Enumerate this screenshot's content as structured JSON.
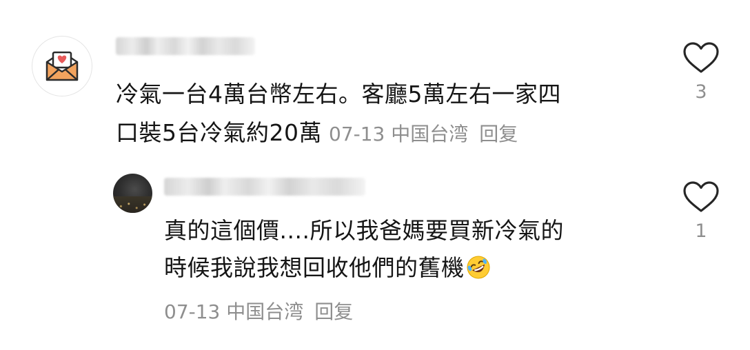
{
  "comment": {
    "avatar_icon": "envelope-heart-icon",
    "username": "",
    "text_line_1": "冷氣一台4萬台幣左右。客廳5萬左右一家四",
    "text_line_2": "口裝5台冷氣約20萬",
    "date": "07-13",
    "location": "中国台湾",
    "reply_label": "回复",
    "likes": "3"
  },
  "reply": {
    "avatar_icon": "night-city-avatar",
    "username": "",
    "text_line_1": "真的這個價....所以我爸媽要買新冷氣的",
    "text_line_2": "時候我說我想回收他們的舊機",
    "emoji": "rolling-on-floor-laughing-emoji",
    "date": "07-13",
    "location": "中国台湾",
    "reply_label": "回复",
    "likes": "1"
  },
  "colors": {
    "text": "#151515",
    "meta": "#8e8e8e",
    "heart_stroke": "#262626",
    "envelope": "#f2a35e",
    "heart": "#e85a5a"
  }
}
